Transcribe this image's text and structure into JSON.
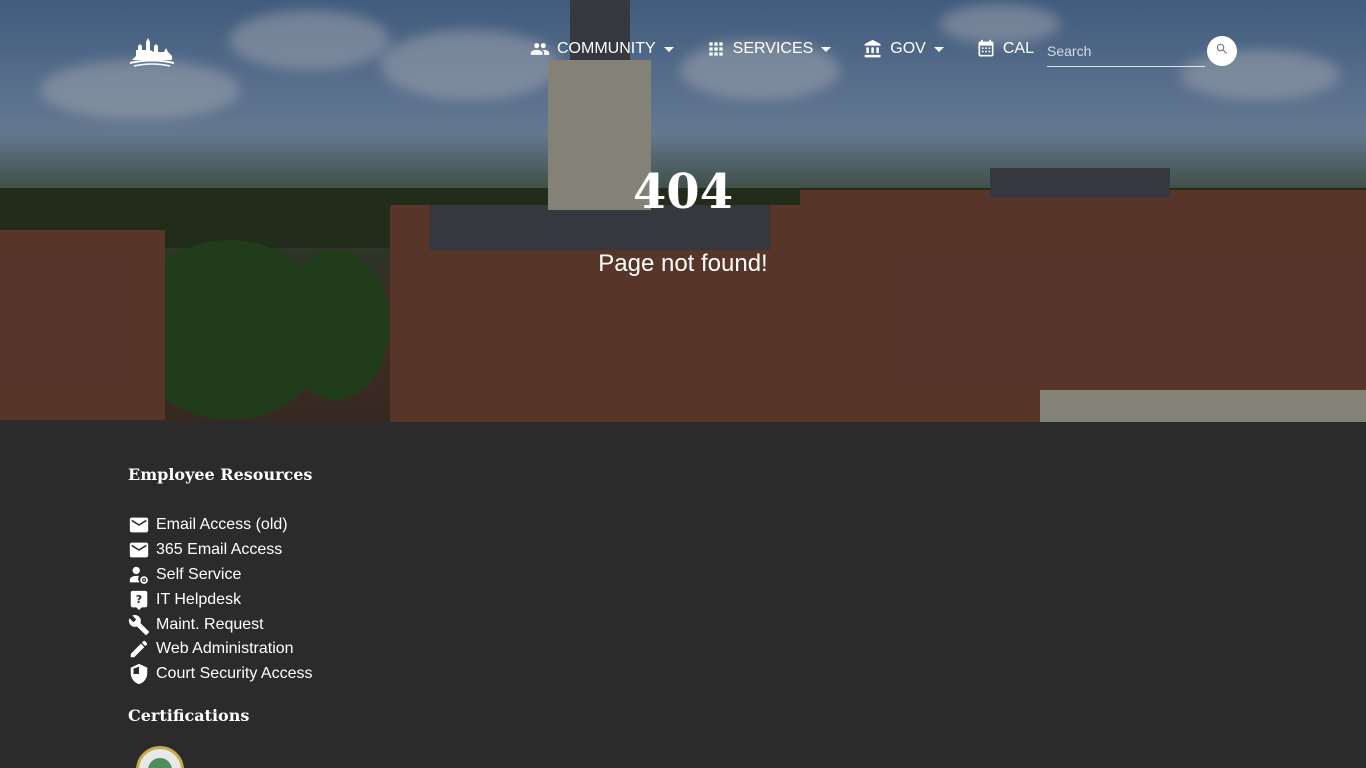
{
  "nav": {
    "items": [
      {
        "label": "COMMUNITY",
        "icon": "people-icon",
        "has_dropdown": true
      },
      {
        "label": "SERVICES",
        "icon": "grid-icon",
        "has_dropdown": true
      },
      {
        "label": "GOV",
        "icon": "government-building-icon",
        "has_dropdown": true
      },
      {
        "label": "CAL",
        "icon": "calendar-icon",
        "has_dropdown": false
      }
    ],
    "search": {
      "placeholder": "Search"
    }
  },
  "hero": {
    "code": "404",
    "message": "Page not found!"
  },
  "footer": {
    "employee_title": "Employee Resources",
    "links": [
      {
        "label": "Email Access (old)",
        "icon": "mail-icon"
      },
      {
        "label": "365 Email Access",
        "icon": "mail-icon"
      },
      {
        "label": "Self Service",
        "icon": "user-gear-icon"
      },
      {
        "label": "IT Helpdesk",
        "icon": "help-icon"
      },
      {
        "label": "Maint. Request",
        "icon": "wrench-icon"
      },
      {
        "label": "Web Administration",
        "icon": "pencil-icon"
      },
      {
        "label": "Court Security Access",
        "icon": "shield-icon"
      }
    ],
    "cert_title": "Certifications"
  },
  "colors": {
    "footer_bg": "#2b2b2b",
    "text": "#ffffff"
  }
}
